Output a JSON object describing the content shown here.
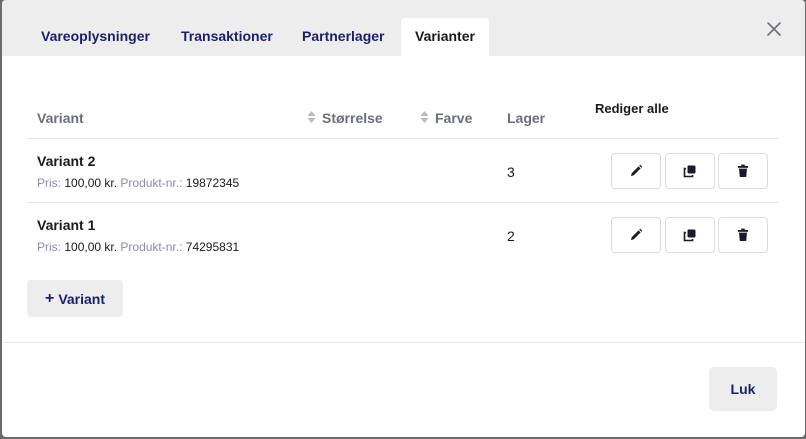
{
  "tabs": [
    {
      "label": "Vareoplysninger",
      "active": false
    },
    {
      "label": "Transaktioner",
      "active": false
    },
    {
      "label": "Partnerlager",
      "active": false
    },
    {
      "label": "Varianter",
      "active": true
    }
  ],
  "table": {
    "headers": {
      "variant": "Variant",
      "size": "Størrelse",
      "color": "Farve",
      "stock": "Lager",
      "edit_all": "Rediger alle"
    },
    "rows": [
      {
        "name": "Variant 2",
        "price_label": "Pris:",
        "price": "100,00 kr.",
        "product_no_label": "Produkt-nr.:",
        "product_no": "19872345",
        "stock": "3"
      },
      {
        "name": "Variant 1",
        "price_label": "Pris:",
        "price": "100,00 kr.",
        "product_no_label": "Produkt-nr.:",
        "product_no": "74295831",
        "stock": "2"
      }
    ]
  },
  "actions": {
    "add_variant_label": "Variant",
    "close_label": "Luk"
  },
  "icons": {
    "close": "close-icon",
    "sort": "sort-icon",
    "edit": "pencil-icon",
    "duplicate": "copy-icon",
    "delete": "trash-icon",
    "add": "plus-icon"
  },
  "colors": {
    "tab_text": "#1b1f6b",
    "tab_bar_bg": "#ededed",
    "header_text": "#6c6f78",
    "meta_label": "#8a8d9b"
  }
}
